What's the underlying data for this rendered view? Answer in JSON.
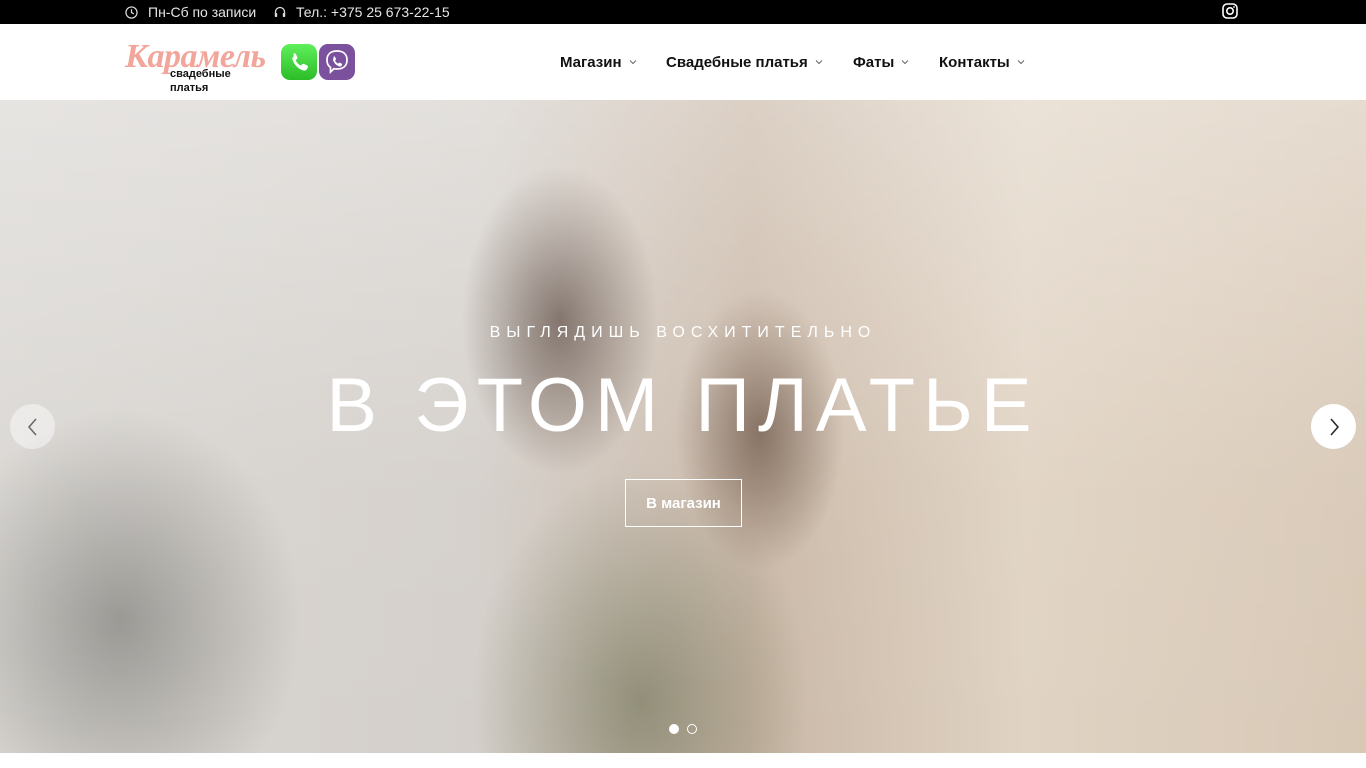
{
  "topbar": {
    "hours_icon": "clock-icon",
    "hours": "Пн-Сб по записи",
    "phone_icon": "headset-icon",
    "phone": "Тел.: +375 25 673-22-15",
    "social_icon": "instagram-icon"
  },
  "header": {
    "logo": {
      "name": "Карамель",
      "tagline": "свадебные платья",
      "color": "#f2a59a"
    },
    "messengers": [
      {
        "icon": "whatsapp-icon",
        "color": "#2cbc28"
      },
      {
        "icon": "viber-icon",
        "color": "#7b519d"
      }
    ],
    "nav": [
      {
        "label": "Магазин",
        "icon": "chevron-down-icon"
      },
      {
        "label": "Свадебные платья",
        "icon": "chevron-down-icon"
      },
      {
        "label": "Фаты",
        "icon": "chevron-down-icon"
      },
      {
        "label": "Контакты",
        "icon": "chevron-down-icon"
      }
    ]
  },
  "hero": {
    "subtitle": "ВЫГЛЯДИШЬ ВОСХИТИТЕЛЬНО",
    "title": "В ЭТОМ ПЛАТЬЕ",
    "button": "В магазин",
    "prev_icon": "chevron-left-icon",
    "next_icon": "chevron-right-icon",
    "slides_total": 2,
    "slide_active": 1
  }
}
